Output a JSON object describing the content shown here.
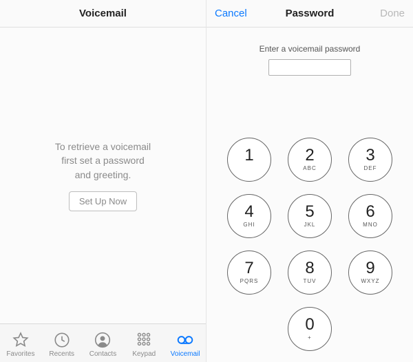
{
  "left": {
    "title": "Voicemail",
    "message": "To retrieve a voicemail\nfirst set a password\nand greeting.",
    "setup_label": "Set Up Now",
    "tabs": [
      {
        "label": "Favorites"
      },
      {
        "label": "Recents"
      },
      {
        "label": "Contacts"
      },
      {
        "label": "Keypad"
      },
      {
        "label": "Voicemail"
      }
    ]
  },
  "right": {
    "cancel_label": "Cancel",
    "title": "Password",
    "done_label": "Done",
    "instruction": "Enter a voicemail password",
    "keypad": [
      {
        "digit": "1",
        "letters": ""
      },
      {
        "digit": "2",
        "letters": "ABC"
      },
      {
        "digit": "3",
        "letters": "DEF"
      },
      {
        "digit": "4",
        "letters": "GHI"
      },
      {
        "digit": "5",
        "letters": "JKL"
      },
      {
        "digit": "6",
        "letters": "MNO"
      },
      {
        "digit": "7",
        "letters": "PQRS"
      },
      {
        "digit": "8",
        "letters": "TUV"
      },
      {
        "digit": "9",
        "letters": "WXYZ"
      },
      {
        "digit": "0",
        "letters": "+"
      }
    ]
  }
}
